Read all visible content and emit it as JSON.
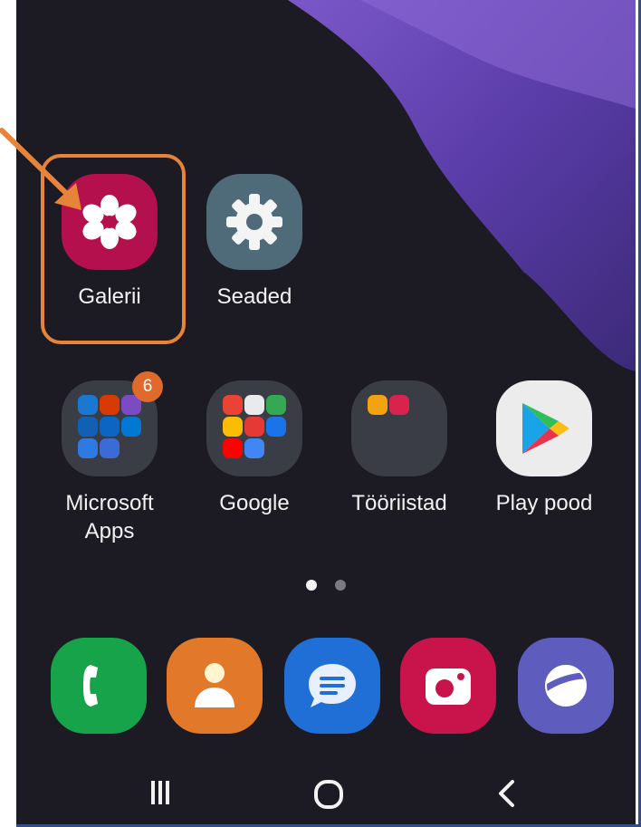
{
  "home": {
    "apps_row1": [
      {
        "label": "Galerii",
        "icon": "gallery-icon",
        "color": "#b4104e"
      },
      {
        "label": "Seaded",
        "icon": "settings-icon",
        "color": "#4f6b79"
      }
    ],
    "apps_row2": [
      {
        "label_line1": "Microsoft",
        "label_line2": "Apps",
        "icon": "microsoft-apps-folder-icon",
        "badge": "6"
      },
      {
        "label": "Google",
        "icon": "google-folder-icon"
      },
      {
        "label": "Tööriistad",
        "icon": "tools-folder-icon"
      },
      {
        "label": "Play pood",
        "icon": "play-store-icon",
        "color": "#ececec"
      }
    ],
    "page_indicator": {
      "pages": 2,
      "active": 1
    }
  },
  "dock": [
    {
      "icon": "phone-icon",
      "color": "#16a34a"
    },
    {
      "icon": "contacts-icon",
      "color": "#e2792a"
    },
    {
      "icon": "messages-icon",
      "color": "#1f6fd6"
    },
    {
      "icon": "camera-icon",
      "color": "#c8144a"
    },
    {
      "icon": "internet-icon",
      "color": "#5e5dbe"
    }
  ],
  "navbar": {
    "recent": "recent-apps-icon",
    "home": "home-icon",
    "back": "back-icon"
  },
  "annotation": {
    "highlight_color": "#e8843a"
  }
}
